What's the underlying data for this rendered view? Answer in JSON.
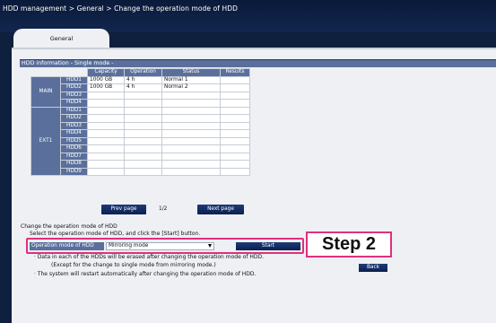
{
  "breadcrumb": "HDD management > General > Change the operation mode of HDD",
  "tab": "General",
  "section_title": "HDD information - Single mode -",
  "table": {
    "headers": [
      "Capacity",
      "Operation",
      "Status",
      "Results"
    ],
    "groups": [
      {
        "name": "MAIN",
        "rows": [
          {
            "hdd": "HDD1",
            "capacity": "1000 GB",
            "operation": "4 h",
            "status": "Normal 1",
            "results": ""
          },
          {
            "hdd": "HDD2",
            "capacity": "1000 GB",
            "operation": "4 h",
            "status": "Normal 2",
            "results": ""
          },
          {
            "hdd": "HDD3",
            "capacity": "",
            "operation": "",
            "status": "",
            "results": ""
          },
          {
            "hdd": "HDD4",
            "capacity": "",
            "operation": "",
            "status": "",
            "results": ""
          }
        ]
      },
      {
        "name": "EXT1",
        "rows": [
          {
            "hdd": "HDD1",
            "capacity": "",
            "operation": "",
            "status": "",
            "results": ""
          },
          {
            "hdd": "HDD2",
            "capacity": "",
            "operation": "",
            "status": "",
            "results": ""
          },
          {
            "hdd": "HDD3",
            "capacity": "",
            "operation": "",
            "status": "",
            "results": ""
          },
          {
            "hdd": "HDD4",
            "capacity": "",
            "operation": "",
            "status": "",
            "results": ""
          },
          {
            "hdd": "HDD5",
            "capacity": "",
            "operation": "",
            "status": "",
            "results": ""
          },
          {
            "hdd": "HDD6",
            "capacity": "",
            "operation": "",
            "status": "",
            "results": ""
          },
          {
            "hdd": "HDD7",
            "capacity": "",
            "operation": "",
            "status": "",
            "results": ""
          },
          {
            "hdd": "HDD8",
            "capacity": "",
            "operation": "",
            "status": "",
            "results": ""
          },
          {
            "hdd": "HDD9",
            "capacity": "",
            "operation": "",
            "status": "",
            "results": ""
          }
        ]
      }
    ]
  },
  "pager": {
    "prev": "Prev page",
    "page": "1/2",
    "next": "Next page"
  },
  "change": {
    "heading": "Change the operation mode of HDD",
    "instruction": "Select the operation mode of HDD, and click the [Start] button.",
    "label": "Operation mode of HDD",
    "selected": "Mirroring mode",
    "start": "Start",
    "note1": "· Data in each of the HDDs will be erased after changing the operation mode of HDD.",
    "note2": "(Except for the change to single mode from mirroring mode.)",
    "note3": "· The system will restart automatically after changing the operation mode of HDD."
  },
  "step_label": "Step 2",
  "back": "Back",
  "colors": {
    "header": "#5a6f9b",
    "button": "#0b1f4e",
    "highlight": "#e0307c",
    "panel": "#eef0f4",
    "background": "#0f1f3e"
  }
}
